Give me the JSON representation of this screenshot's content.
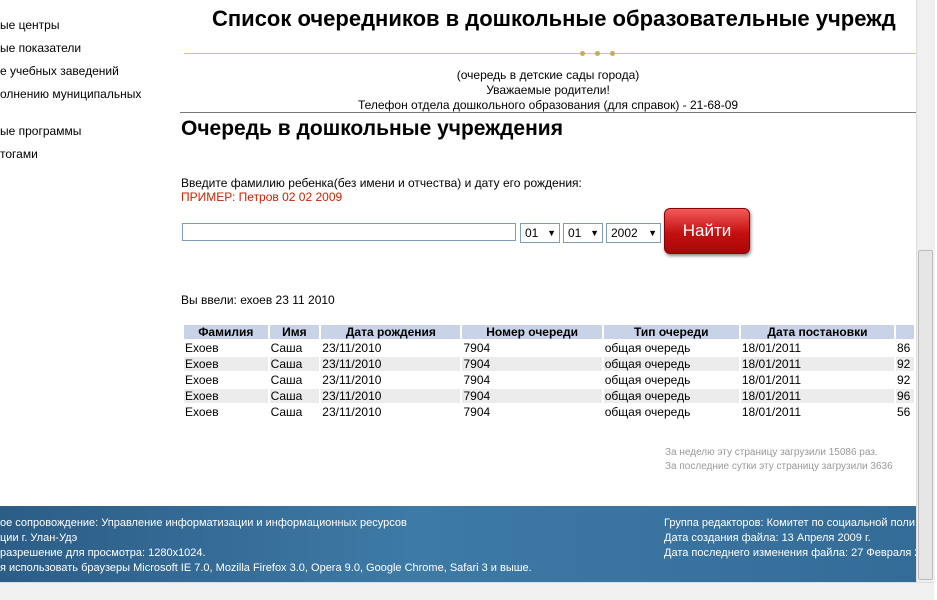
{
  "sidebar": {
    "items": [
      "ые центры",
      "ые показатели",
      "е учебных заведений",
      "олнению муниципальных",
      "ые программы",
      "тогами"
    ]
  },
  "header": {
    "title": "Список очередников в дошкольные образовательные учрежд",
    "subtitle": "(очередь в детские сады города)",
    "greeting": "Уважаемые родители!",
    "phone": "Телефон отдела дошкольного образования (для справок) - 21-68-09"
  },
  "search": {
    "section_title": "Очередь в дошкольные учреждения",
    "instruction": "Введите фамилию ребенка(без имени и отчества) и дату его рождения:",
    "example": "ПРИМЕР: Петров 02 02 2009",
    "input_value": "",
    "day": "01",
    "month": "01",
    "year": "2002",
    "button_label": "Найти"
  },
  "entered": "Вы ввели: ехоев 23 11 2010",
  "table": {
    "headers": [
      "Фамилия",
      "Имя",
      "Дата рождения",
      "Номер очереди",
      "Тип очереди",
      "Дата постановки",
      ""
    ],
    "rows": [
      [
        "Ехоев",
        "Саша",
        "23/11/2010",
        "7904",
        "общая очередь",
        "18/01/2011",
        "86"
      ],
      [
        "Ехоев",
        "Саша",
        "23/11/2010",
        "7904",
        "общая очередь",
        "18/01/2011",
        "92"
      ],
      [
        "Ехоев",
        "Саша",
        "23/11/2010",
        "7904",
        "общая очередь",
        "18/01/2011",
        "92"
      ],
      [
        "Ехоев",
        "Саша",
        "23/11/2010",
        "7904",
        "общая очередь",
        "18/01/2011",
        "96"
      ],
      [
        "Ехоев",
        "Саша",
        "23/11/2010",
        "7904",
        "общая очередь",
        "18/01/2011",
        "56"
      ]
    ]
  },
  "stats": {
    "week": "За неделю эту страницу загрузили 15086 раз.",
    "day": "За последние сутки эту страницу загрузили 3636"
  },
  "footer": {
    "left": [
      "ое сопровождение: Управление информатизации и информационных ресурсов",
      "ции г. Улан-Удэ",
      "разрешение для просмотра: 1280x1024.",
      "я использовать браузеры Microsoft IE 7.0, Mozilla Firefox 3.0, Opera 9.0, Google Chrome, Safari 3 и выше."
    ],
    "right": [
      "Группа редакторов: Комитет по социальной поли",
      "Дата создания файла: 13 Апреля 2009 г.",
      "Дата последнего изменения файла: 27 Февраля 2"
    ]
  },
  "colors": {
    "example_text": "#cc2200",
    "button": "#c40f0f",
    "table_header": "#c8d3e8",
    "footer_bg": "#346c98"
  }
}
